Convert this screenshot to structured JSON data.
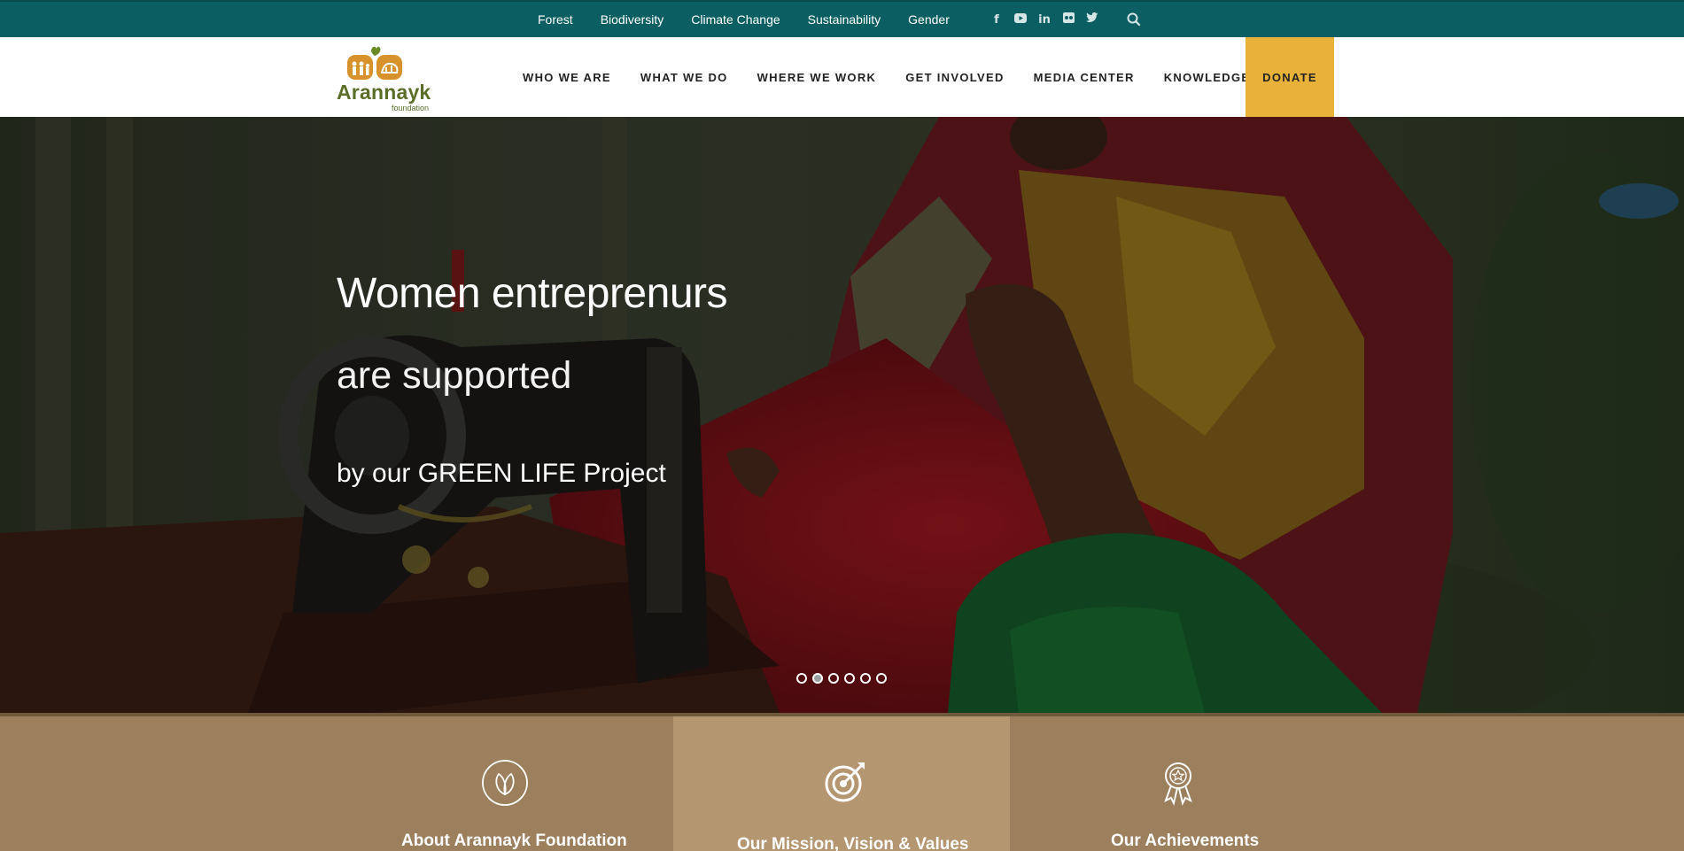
{
  "topbar": {
    "links": [
      "Forest",
      "Biodiversity",
      "Climate Change",
      "Sustainability",
      "Gender"
    ],
    "social": [
      {
        "name": "facebook-icon",
        "glyph": "f"
      },
      {
        "name": "youtube-icon",
        "glyph": "▶"
      },
      {
        "name": "linkedin-icon",
        "glyph": "in"
      },
      {
        "name": "flickr-icon",
        "glyph": "●●"
      },
      {
        "name": "twitter-icon",
        "glyph": "🐦"
      }
    ],
    "search_icon": "search-icon"
  },
  "header": {
    "logo_name": "Arannayk",
    "logo_sub": "foundation",
    "nav": [
      "WHO WE ARE",
      "WHAT WE DO",
      "WHERE WE WORK",
      "GET INVOLVED",
      "MEDIA CENTER",
      "KNOWLEDGE"
    ],
    "donate": "DONATE"
  },
  "hero": {
    "line1": "Women entreprenurs",
    "line2": "are supported",
    "line3": "by our GREEN LIFE Project",
    "slides": 6,
    "active_slide": 2
  },
  "features": [
    {
      "title": "About Arannayk Foundation",
      "icon": "leaf-icon"
    },
    {
      "title": "Our Mission, Vision & Values",
      "icon": "target-icon"
    },
    {
      "title": "Our Achievements",
      "icon": "award-ribbon-icon"
    }
  ],
  "colors": {
    "topbar": "#0b5f63",
    "donate": "#e8b13a",
    "feature_dark": "#9c7f5d",
    "feature_light": "#b49671",
    "logo": "#5a6e2a"
  }
}
